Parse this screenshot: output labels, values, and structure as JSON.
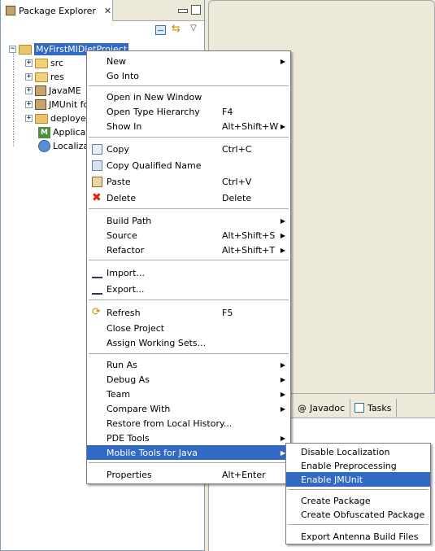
{
  "explorer": {
    "tab_title": "Package Explorer",
    "tab_close": "✕",
    "tree": [
      {
        "label": "MyFirstMIDletProject",
        "expander": "−",
        "icon": "project-folder-icon"
      },
      {
        "label": "src",
        "expander": "+",
        "icon": "package-folder-icon"
      },
      {
        "label": "res",
        "expander": "+",
        "icon": "package-folder-icon"
      },
      {
        "label": "JavaME",
        "expander": "+",
        "icon": "jar-library-icon"
      },
      {
        "label": "JMUnit fo",
        "expander": "+",
        "icon": "jar-library-icon"
      },
      {
        "label": "deployed",
        "expander": "+",
        "icon": "folder-icon"
      },
      {
        "label": "Applicati",
        "expander": "",
        "icon": "midlet-m-icon"
      },
      {
        "label": "Localizati",
        "expander": "",
        "icon": "localization-globe-icon"
      }
    ]
  },
  "bottom_tabs": {
    "javadoc": "Javadoc",
    "javadoc_icon": "@",
    "tasks": "Tasks"
  },
  "context_menu": {
    "items": [
      {
        "label": "New",
        "accel": "",
        "submenu": true
      },
      {
        "label": "Go Into",
        "accel": "",
        "submenu": false
      },
      {
        "label": "Open in New Window",
        "accel": "",
        "submenu": false
      },
      {
        "label": "Open Type Hierarchy",
        "accel": "F4",
        "submenu": false
      },
      {
        "label": "Show In",
        "accel": "Alt+Shift+W",
        "submenu": true
      },
      {
        "label": "Copy",
        "accel": "Ctrl+C",
        "submenu": false,
        "icon": "copy-icon"
      },
      {
        "label": "Copy Qualified Name",
        "accel": "",
        "submenu": false,
        "icon": "copy-qualified-name-icon"
      },
      {
        "label": "Paste",
        "accel": "Ctrl+V",
        "submenu": false,
        "icon": "paste-icon"
      },
      {
        "label": "Delete",
        "accel": "Delete",
        "submenu": false,
        "icon": "delete-icon"
      },
      {
        "label": "Build Path",
        "accel": "",
        "submenu": true
      },
      {
        "label": "Source",
        "accel": "Alt+Shift+S",
        "submenu": true
      },
      {
        "label": "Refactor",
        "accel": "Alt+Shift+T",
        "submenu": true
      },
      {
        "label": "Import...",
        "accel": "",
        "submenu": false,
        "icon": "import-icon"
      },
      {
        "label": "Export...",
        "accel": "",
        "submenu": false,
        "icon": "export-icon"
      },
      {
        "label": "Refresh",
        "accel": "F5",
        "submenu": false,
        "icon": "refresh-icon"
      },
      {
        "label": "Close Project",
        "accel": "",
        "submenu": false
      },
      {
        "label": "Assign Working Sets...",
        "accel": "",
        "submenu": false
      },
      {
        "label": "Run As",
        "accel": "",
        "submenu": true
      },
      {
        "label": "Debug As",
        "accel": "",
        "submenu": true
      },
      {
        "label": "Team",
        "accel": "",
        "submenu": true
      },
      {
        "label": "Compare With",
        "accel": "",
        "submenu": true
      },
      {
        "label": "Restore from Local History...",
        "accel": "",
        "submenu": false
      },
      {
        "label": "PDE Tools",
        "accel": "",
        "submenu": true
      },
      {
        "label": "Mobile Tools for Java",
        "accel": "",
        "submenu": true,
        "highlighted": true
      },
      {
        "label": "Properties",
        "accel": "Alt+Enter",
        "submenu": false
      }
    ],
    "arrow": "▶"
  },
  "submenu": {
    "items": [
      {
        "label": "Disable Localization"
      },
      {
        "label": "Enable Preprocessing"
      },
      {
        "label": "Enable JMUnit",
        "highlighted": true
      },
      {
        "label": "Create Package"
      },
      {
        "label": "Create Obfuscated Package"
      },
      {
        "label": "Export Antenna Build Files"
      }
    ]
  },
  "colors": {
    "selection": "#316ac5",
    "window_bg": "#ece9d8",
    "border": "#7f9db9"
  }
}
